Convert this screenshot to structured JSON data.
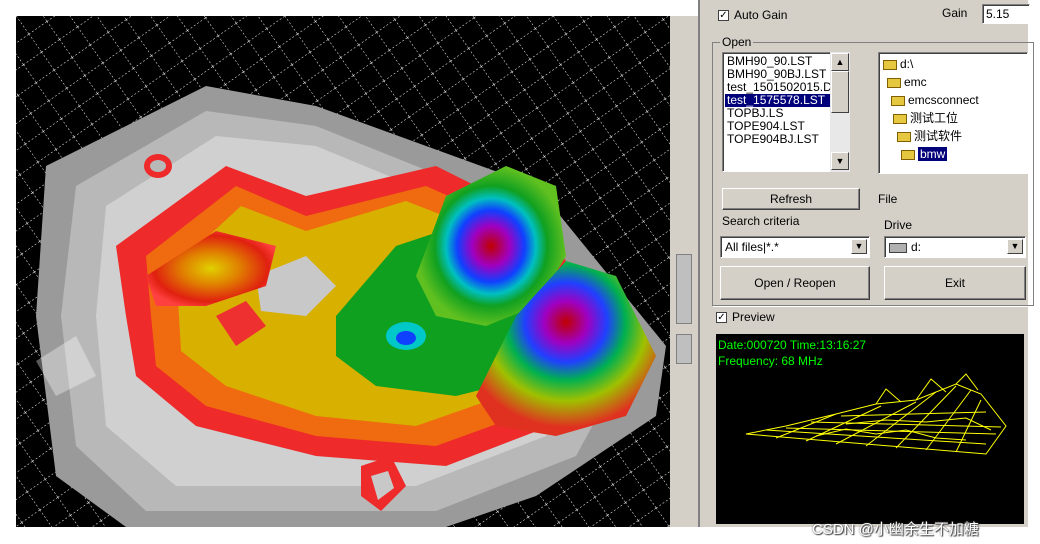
{
  "controls": {
    "auto_gain_label": "Auto Gain",
    "auto_gain_checked": true,
    "gain_label": "Gain",
    "gain_value": "5.15"
  },
  "open_group": {
    "title": "Open",
    "files": [
      "BMH90_90.LST",
      "BMH90_90BJ.LST",
      "test_1501502015.D",
      "test_1575578.LST",
      "TOPBJ.LS",
      "TOPE904.LST",
      "TOPE904BJ.LST"
    ],
    "selected_file_index": 3,
    "folders": [
      "d:\\",
      "emc",
      "emcsconnect",
      "测试工位",
      "测试软件",
      "bmw"
    ],
    "selected_folder_index": 5,
    "refresh_label": "Refresh",
    "file_label": "File",
    "search_label": "Search criteria",
    "search_value": "All files|*.*",
    "drive_label": "Drive",
    "drive_value": "d:",
    "open_label": "Open / Reopen",
    "exit_label": "Exit"
  },
  "preview": {
    "label": "Preview",
    "checked": true,
    "date_line": "Date:000720  Time:13:16:27",
    "freq_line": "Frequency: 68 MHz"
  },
  "watermark": "CSDN @小幽余生不加糖",
  "colors": {
    "panel_bg": "#d4d0c8",
    "selection": "#00007a",
    "preview_text": "#00ff00",
    "wireframe": "#ffff00"
  }
}
